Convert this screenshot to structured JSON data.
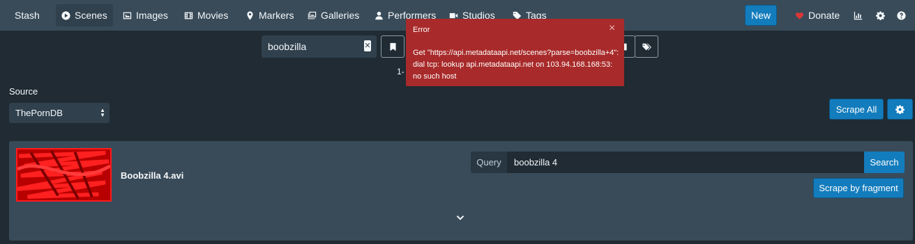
{
  "nav": {
    "brand": "Stash",
    "items": [
      {
        "label": "Scenes",
        "icon": "play-circle-icon",
        "active": true
      },
      {
        "label": "Images",
        "icon": "image-icon"
      },
      {
        "label": "Movies",
        "icon": "film-icon"
      },
      {
        "label": "Markers",
        "icon": "map-marker-icon"
      },
      {
        "label": "Galleries",
        "icon": "images-icon"
      },
      {
        "label": "Performers",
        "icon": "user-icon"
      },
      {
        "label": "Studios",
        "icon": "video-icon"
      },
      {
        "label": "Tags",
        "icon": "tag-icon"
      }
    ],
    "new_label": "New",
    "donate_label": "Donate"
  },
  "filter": {
    "search_value": "boobzilla",
    "pagination": "1-"
  },
  "source": {
    "label": "Source",
    "selected": "ThePornDB"
  },
  "buttons": {
    "scrape_all": "Scrape All",
    "search": "Search",
    "scrape_fragment": "Scrape by fragment"
  },
  "scene": {
    "title": "Boobzilla 4.avi",
    "query_label": "Query",
    "query_value": "boobzilla 4"
  },
  "toast": {
    "header": "Error",
    "close": "×",
    "message": "Get \"https://api.metadataapi.net/scenes?parse=boobzilla+4\": dial tcp: lookup api.metadataapi.net on 103.94.168.168:53: no such host"
  },
  "colors": {
    "navbar": "#394b59",
    "background": "#202b33",
    "primary": "#137cbd",
    "error": "#a82a2a"
  }
}
